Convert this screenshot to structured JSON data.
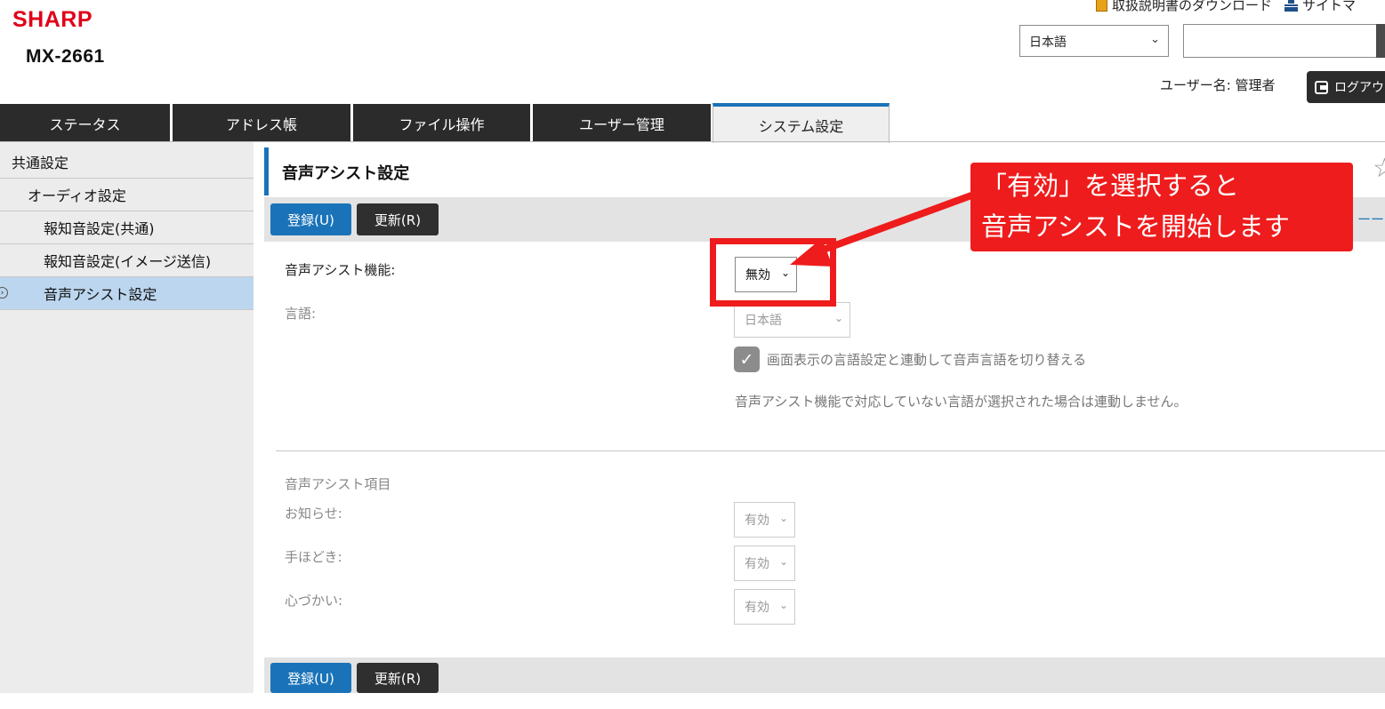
{
  "header": {
    "brand": "SHARP",
    "model": "MX-2661",
    "manual_download": "取扱説明書のダウンロード",
    "sitemap": "サイトマ",
    "language": "日本語",
    "language_chevron": "⌄",
    "search_value": "",
    "username_text": "ユーザー名: 管理者",
    "logout_label": "ログアウ"
  },
  "tabs": [
    {
      "label": "ステータス"
    },
    {
      "label": "アドレス帳"
    },
    {
      "label": "ファイル操作"
    },
    {
      "label": "ユーザー管理"
    },
    {
      "label": "システム設定",
      "active": true
    }
  ],
  "sidebar": {
    "items": [
      {
        "label": "共通設定"
      },
      {
        "label": "オーディオ設定"
      },
      {
        "label": "報知音設定(共通)"
      },
      {
        "label": "報知音設定(イメージ送信)"
      },
      {
        "label": "音声アシスト設定",
        "selected": true
      }
    ],
    "selected_marker": "›"
  },
  "main": {
    "title": "音声アシスト設定",
    "star": "☆",
    "register_label": "登録(U)",
    "update_label": "更新(R)",
    "strip_link": "ーー",
    "voice_assist_label": "音声アシスト機能:",
    "voice_assist_value": "無効",
    "language_label": "言語:",
    "language_value": "日本語",
    "sync_checkbox_label": "画面表示の言語設定と連動して音声言語を切り替える",
    "checkmark": "✓",
    "note": "音声アシスト機能で対応していない言語が選択された場合は連動しません。",
    "items_heading": "音声アシスト項目",
    "items": [
      {
        "label": "お知らせ:",
        "value": "有効"
      },
      {
        "label": "手ほどき:",
        "value": "有効"
      },
      {
        "label": "心づかい:",
        "value": "有効"
      }
    ],
    "chevron": "⌄"
  },
  "annotation": {
    "line1": "「有効」を選択すると",
    "line2": "音声アシストを開始します",
    "color": "#ee1c1c"
  },
  "colors": {
    "brand_red": "#e1001a",
    "accent_blue": "#1a73b8",
    "tab_dark": "#2b2b2b",
    "sidebar_selected": "#bcd6ef"
  }
}
